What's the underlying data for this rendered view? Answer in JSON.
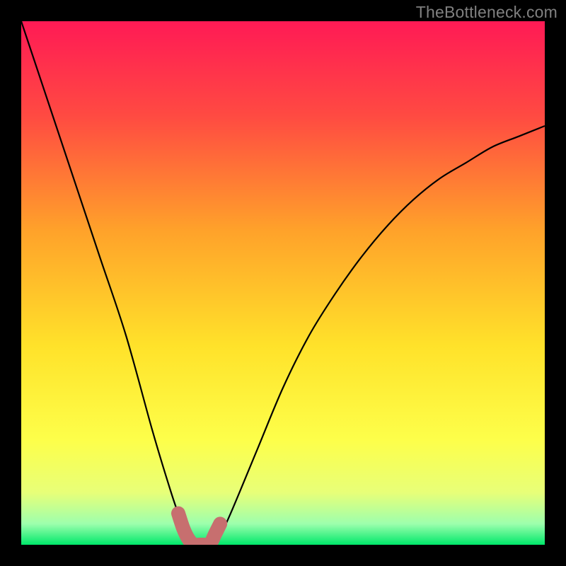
{
  "watermark": "TheBottleneck.com",
  "chart_data": {
    "type": "line",
    "title": "",
    "xlabel": "",
    "ylabel": "",
    "xlim": [
      0,
      100
    ],
    "ylim": [
      0,
      100
    ],
    "grid": false,
    "series": [
      {
        "name": "bottleneck-curve",
        "x": [
          0,
          5,
          10,
          15,
          20,
          25,
          28,
          30,
          32,
          34,
          35,
          36,
          38,
          40,
          45,
          50,
          55,
          60,
          65,
          70,
          75,
          80,
          85,
          90,
          95,
          100
        ],
        "y": [
          100,
          85,
          70,
          55,
          40,
          22,
          12,
          6,
          2,
          0,
          0,
          0,
          2,
          6,
          18,
          30,
          40,
          48,
          55,
          61,
          66,
          70,
          73,
          76,
          78,
          80
        ]
      }
    ],
    "overlay_segment": {
      "name": "highlighted-range",
      "x": [
        30,
        31,
        32,
        33,
        34,
        35,
        36,
        37,
        38
      ],
      "y": [
        6,
        3,
        1,
        0,
        0,
        0,
        0,
        2,
        4
      ],
      "color": "#c76f6f"
    },
    "background": {
      "type": "vertical-gradient",
      "stops": [
        {
          "pos": 0.0,
          "color": "#ff1a55"
        },
        {
          "pos": 0.18,
          "color": "#ff4a42"
        },
        {
          "pos": 0.4,
          "color": "#ffa22a"
        },
        {
          "pos": 0.62,
          "color": "#ffe22a"
        },
        {
          "pos": 0.8,
          "color": "#fdff4a"
        },
        {
          "pos": 0.9,
          "color": "#e8ff78"
        },
        {
          "pos": 0.96,
          "color": "#9dffad"
        },
        {
          "pos": 1.0,
          "color": "#00e86a"
        }
      ]
    }
  }
}
